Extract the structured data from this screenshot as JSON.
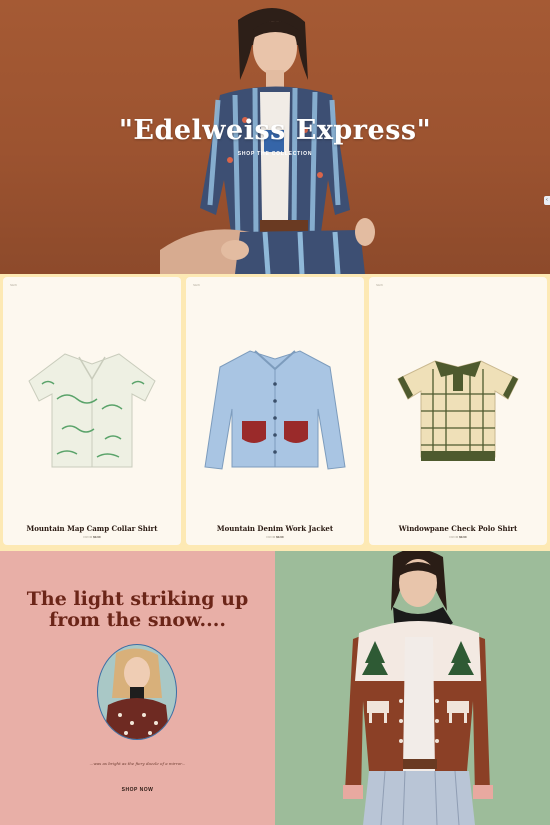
{
  "hero": {
    "title": "\"Edelweiss Express\"",
    "cta_label": "SHOP THE COLLECTION",
    "side_tab": "‹"
  },
  "products": [
    {
      "tag": "NEW",
      "name": "Mountain Map Camp Collar Shirt",
      "price_note": "FROM",
      "price": "$0.00",
      "image_icon": "camp-collar-shirt-icon"
    },
    {
      "tag": "NEW",
      "name": "Mountain Denim Work Jacket",
      "price_note": "FROM",
      "price": "$0.00",
      "image_icon": "denim-jacket-icon"
    },
    {
      "tag": "NEW",
      "name": "Windowpane Check Polo Shirt",
      "price_note": "FROM",
      "price": "$0.00",
      "image_icon": "polo-shirt-icon"
    }
  ],
  "promo": {
    "heading": "The light striking up from the snow....",
    "caption": "...was as bright as the fiery dazzle of a mirror...",
    "cta_label": "SHOP NOW"
  },
  "colors": {
    "hero_bg": "#9c5330",
    "product_band": "#fde9b4",
    "promo_bg": "#e8afa7",
    "promo_heading": "#6b2518",
    "feature_bg": "#9dbc9a"
  }
}
